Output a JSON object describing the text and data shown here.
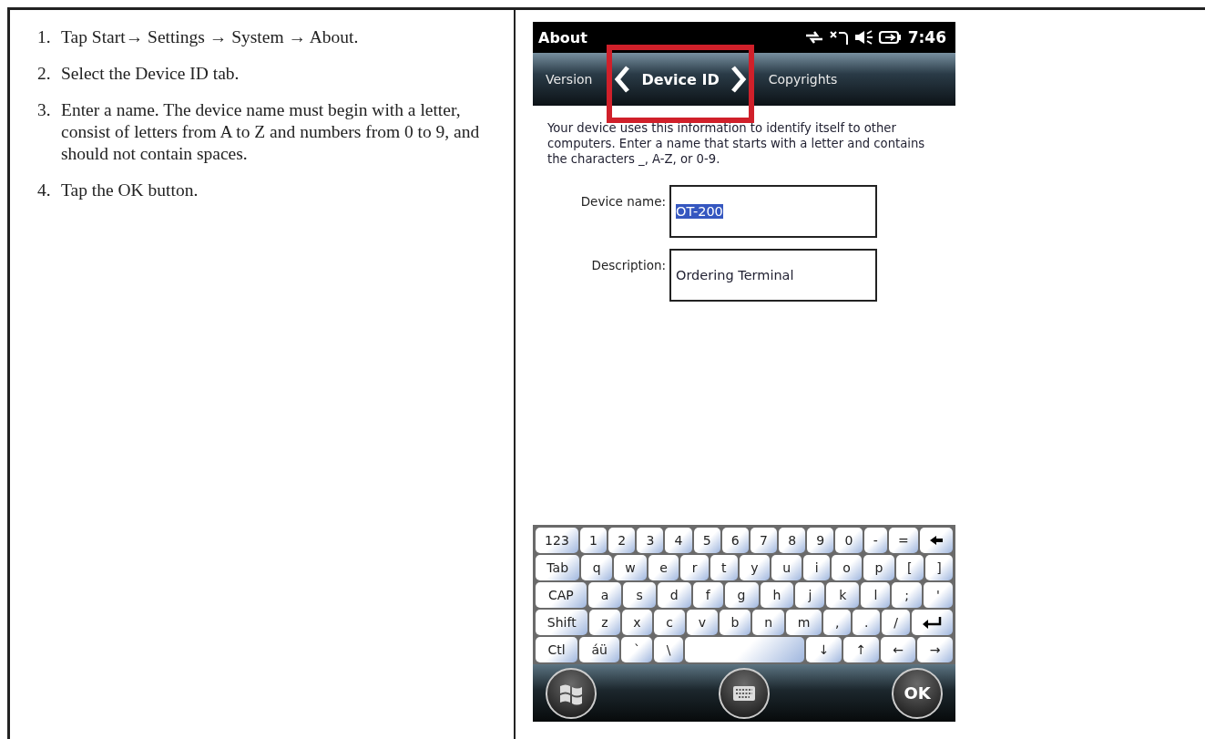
{
  "steps": [
    {
      "number": "1.",
      "text": "Tap Start→ Settings → System → About."
    },
    {
      "number": "2.",
      "text": "Select the Device ID tab."
    },
    {
      "number": "3.",
      "text": "Enter a name. The device name must begin with a letter, consist of letters from A to Z and numbers from 0 to 9, and should not contain spaces."
    },
    {
      "number": "4.",
      "text": "Tap the OK button."
    }
  ],
  "device": {
    "title": "About",
    "time": "7:46",
    "tabs": [
      {
        "label": "Version",
        "selected": false
      },
      {
        "label": "Device ID",
        "selected": true
      },
      {
        "label": "Copyrights",
        "selected": false
      }
    ],
    "description": "Your device uses this information to identify itself to other computers. Enter a name that starts with a letter and contains the characters _, A-Z, or 0-9.",
    "fields": [
      {
        "label": "Device name:",
        "value": "OT-200",
        "selected": true
      },
      {
        "label": "Description:",
        "value": "Ordering Terminal",
        "selected": false
      }
    ],
    "keyboard": [
      [
        {
          "kind": "key",
          "label": "123"
        },
        {
          "kind": "key",
          "label": "1"
        },
        {
          "kind": "key",
          "label": "2"
        },
        {
          "kind": "key",
          "label": "3"
        },
        {
          "kind": "key",
          "label": "4"
        },
        {
          "kind": "key",
          "label": "5"
        },
        {
          "kind": "key",
          "label": "6"
        },
        {
          "kind": "key",
          "label": "7"
        },
        {
          "kind": "key",
          "label": "8"
        },
        {
          "kind": "key",
          "label": "9"
        },
        {
          "kind": "key",
          "label": "0"
        },
        {
          "kind": "key",
          "label": "-"
        },
        {
          "kind": "key",
          "label": "="
        },
        {
          "kind": "backspace"
        }
      ],
      [
        {
          "kind": "key",
          "label": "Tab"
        },
        {
          "kind": "key",
          "label": "q"
        },
        {
          "kind": "key",
          "label": "w"
        },
        {
          "kind": "key",
          "label": "e"
        },
        {
          "kind": "key",
          "label": "r"
        },
        {
          "kind": "key",
          "label": "t"
        },
        {
          "kind": "key",
          "label": "y"
        },
        {
          "kind": "key",
          "label": "u"
        },
        {
          "kind": "key",
          "label": "i"
        },
        {
          "kind": "key",
          "label": "o"
        },
        {
          "kind": "key",
          "label": "p"
        },
        {
          "kind": "key",
          "label": "["
        },
        {
          "kind": "key",
          "label": "]"
        }
      ],
      [
        {
          "kind": "key",
          "label": "CAP"
        },
        {
          "kind": "key",
          "label": "a"
        },
        {
          "kind": "key",
          "label": "s"
        },
        {
          "kind": "key",
          "label": "d"
        },
        {
          "kind": "key",
          "label": "f"
        },
        {
          "kind": "key",
          "label": "g"
        },
        {
          "kind": "key",
          "label": "h"
        },
        {
          "kind": "key",
          "label": "j"
        },
        {
          "kind": "key",
          "label": "k"
        },
        {
          "kind": "key",
          "label": "l"
        },
        {
          "kind": "key",
          "label": ";"
        },
        {
          "kind": "key",
          "label": "'"
        }
      ],
      [
        {
          "kind": "key",
          "label": "Shift"
        },
        {
          "kind": "key",
          "label": "z"
        },
        {
          "kind": "key",
          "label": "x"
        },
        {
          "kind": "key",
          "label": "c"
        },
        {
          "kind": "key",
          "label": "v"
        },
        {
          "kind": "key",
          "label": "b"
        },
        {
          "kind": "key",
          "label": "n"
        },
        {
          "kind": "key",
          "label": "m"
        },
        {
          "kind": "key",
          "label": ","
        },
        {
          "kind": "key",
          "label": "."
        },
        {
          "kind": "key",
          "label": "/"
        },
        {
          "kind": "enter"
        }
      ],
      [
        {
          "kind": "key",
          "label": "Ctl"
        },
        {
          "kind": "key",
          "label": "áü"
        },
        {
          "kind": "key",
          "label": "`"
        },
        {
          "kind": "key",
          "label": "\\"
        },
        {
          "kind": "space"
        },
        {
          "kind": "key",
          "label": "↓"
        },
        {
          "kind": "key",
          "label": "↑"
        },
        {
          "kind": "key",
          "label": "←"
        },
        {
          "kind": "key",
          "label": "→"
        }
      ]
    ],
    "ok_label": "OK"
  }
}
